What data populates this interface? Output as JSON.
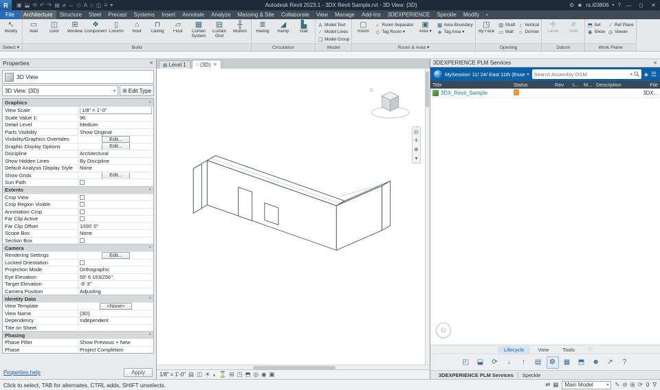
{
  "colors": {
    "titlebar": "#1f2a37",
    "tabrow": "#3e4a54",
    "file_blue": "#2a6bb5",
    "plm_blue": "#0d60a6",
    "selection_teal": "#1b7a8c",
    "status_orange": "#e89a3c"
  },
  "title_bar": {
    "app_title": "Autodesk Revit 2023.1 - 3DX Revit Sample.rvt - 3D View: {3D}",
    "logo_letter": "R",
    "qat_icons": [
      {
        "name": "open-file-icon",
        "glyph": "▣"
      },
      {
        "name": "save-icon",
        "glyph": "⬓"
      },
      {
        "name": "sync-icon",
        "glyph": "⟲"
      },
      {
        "name": "undo-icon",
        "glyph": "↶"
      },
      {
        "name": "redo-icon",
        "glyph": "↷"
      },
      {
        "name": "print-icon",
        "glyph": "▤"
      },
      {
        "name": "measure-icon",
        "glyph": "⌀"
      },
      {
        "name": "aligned-dimension-icon",
        "glyph": "↔"
      },
      {
        "name": "tag-by-category-icon",
        "glyph": "◇"
      },
      {
        "name": "text-icon",
        "glyph": "A"
      },
      {
        "name": "default-3d-view-icon",
        "glyph": "⌂"
      },
      {
        "name": "section-icon",
        "glyph": "◫"
      },
      {
        "name": "thin-lines-icon",
        "glyph": "≡"
      },
      {
        "name": "customize-qat-icon",
        "glyph": "▾"
      }
    ],
    "right_icons": [
      {
        "name": "gear-icon",
        "glyph": "⚙"
      },
      {
        "name": "user-avatar-icon",
        "glyph": "☻"
      }
    ],
    "user_name": "rs.i03806",
    "user_menu_icon": "▾",
    "help_icon": "?",
    "window": {
      "minimize_icon": "—",
      "restore_icon": "◻",
      "close_icon": "✕"
    }
  },
  "ribbon": {
    "file_label": "File",
    "tabs": [
      "Architecture",
      "Structure",
      "Steel",
      "Precast",
      "Systems",
      "Insert",
      "Annotate",
      "Analyze",
      "Massing & Site",
      "Collaborate",
      "View",
      "Manage",
      "Add-Ins",
      "3DEXPERIENCE",
      "Speckle",
      "Modify"
    ],
    "active_tab": "Architecture",
    "tab_overflow_icon": "▾",
    "panels": [
      {
        "label": "Select ▾",
        "items": [
          {
            "kind": "big",
            "label": "Modify",
            "icon": "↖"
          }
        ]
      },
      {
        "label": "Build",
        "items": [
          {
            "kind": "big",
            "label": "Wall",
            "icon": "▭"
          },
          {
            "kind": "big",
            "label": "Door",
            "icon": "◫"
          },
          {
            "kind": "big",
            "label": "Window",
            "icon": "⊞"
          },
          {
            "kind": "big",
            "label": "Component",
            "icon": "❖"
          },
          {
            "kind": "big",
            "label": "Column",
            "icon": "▯"
          },
          {
            "kind": "big",
            "label": "Roof",
            "icon": "⌂"
          },
          {
            "kind": "big",
            "label": "Ceiling",
            "icon": "⊓"
          },
          {
            "kind": "big",
            "label": "Floor",
            "icon": "▱"
          },
          {
            "kind": "big",
            "label": "Curtain System",
            "icon": "▦"
          },
          {
            "kind": "big",
            "label": "Curtain Grid",
            "icon": "▤"
          },
          {
            "kind": "big",
            "label": "Mullion",
            "icon": "╫"
          }
        ]
      },
      {
        "label": "Circulation",
        "items": [
          {
            "kind": "big",
            "label": "Railing",
            "icon": "≣"
          },
          {
            "kind": "big",
            "label": "Ramp",
            "icon": "◢"
          },
          {
            "kind": "big",
            "label": "Stair",
            "icon": "▙"
          }
        ]
      },
      {
        "label": "Model",
        "items": [
          {
            "kind": "stack",
            "items": [
              {
                "label": "Model Text",
                "icon": "A"
              },
              {
                "label": "Model Lines",
                "icon": "∕"
              },
              {
                "label": "Model Group",
                "icon": "❏"
              }
            ]
          }
        ]
      },
      {
        "label": "Room & Area ▾",
        "items": [
          {
            "kind": "big",
            "label": "Room",
            "icon": "▢"
          },
          {
            "kind": "stack",
            "items": [
              {
                "label": "Room Separator",
                "icon": "⌐"
              },
              {
                "label": "Tag Room ▾",
                "icon": "◇"
              }
            ]
          },
          {
            "kind": "big",
            "label": "Area ▾",
            "icon": "▣"
          },
          {
            "kind": "stack",
            "items": [
              {
                "label": "Area Boundary",
                "icon": "▩"
              },
              {
                "label": "Tag Area ▾",
                "icon": "◈"
              }
            ]
          }
        ]
      },
      {
        "label": "Opening",
        "items": [
          {
            "kind": "big",
            "label": "By Face",
            "icon": "◳"
          },
          {
            "kind": "stack",
            "items": [
              {
                "label": "Shaft",
                "icon": "▥"
              },
              {
                "label": "Wall",
                "icon": "▭"
              }
            ]
          },
          {
            "kind": "stack",
            "items": [
              {
                "label": "Vertical",
                "icon": "↕"
              },
              {
                "label": "Dormer",
                "icon": "⌂"
              }
            ]
          }
        ]
      },
      {
        "label": "Datum",
        "disabled": true,
        "items": [
          {
            "kind": "big",
            "label": "Level",
            "icon": "✛"
          },
          {
            "kind": "big",
            "label": "Grid",
            "icon": "#"
          }
        ]
      },
      {
        "label": "Work Plane",
        "items": [
          {
            "kind": "stack",
            "items": [
              {
                "label": "Set",
                "icon": "⬒"
              },
              {
                "label": "Show",
                "icon": "◉"
              }
            ]
          },
          {
            "kind": "stack",
            "items": [
              {
                "label": "Ref Plane",
                "icon": "∕"
              },
              {
                "label": "Viewer",
                "icon": "◎"
              }
            ]
          }
        ]
      }
    ]
  },
  "properties": {
    "title": "Properties",
    "close_icon": "✕",
    "type_name": "3D View",
    "instance_label": "3D View: {3D}",
    "dropdown_icon": "▾",
    "edit_type_icon": "▦",
    "edit_type_label": "Edit Type",
    "groups": [
      {
        "name": "Graphics",
        "rows": [
          {
            "label": "View Scale",
            "value": "1/8\" = 1'-0\"",
            "type": "select"
          },
          {
            "label": "Scale Value    1:",
            "value": "96",
            "type": "text"
          },
          {
            "label": "Detail Level",
            "value": "Medium",
            "type": "text"
          },
          {
            "label": "Parts Visibility",
            "value": "Show Original",
            "type": "text"
          },
          {
            "label": "Visibility/Graphics Overrides",
            "value": "Edit...",
            "type": "button"
          },
          {
            "label": "Graphic Display Options",
            "value": "Edit...",
            "type": "button"
          },
          {
            "label": "Discipline",
            "value": "Architectural",
            "type": "text"
          },
          {
            "label": "Show Hidden Lines",
            "value": "By Discipline",
            "type": "text"
          },
          {
            "label": "Default Analysis Display Style",
            "value": "None",
            "type": "text"
          },
          {
            "label": "Show Grids",
            "value": "Edit...",
            "type": "button"
          },
          {
            "label": "Sun Path",
            "value": "",
            "type": "checkbox"
          }
        ]
      },
      {
        "name": "Extents",
        "rows": [
          {
            "label": "Crop View",
            "value": "",
            "type": "checkbox"
          },
          {
            "label": "Crop Region Visible",
            "value": "",
            "type": "checkbox"
          },
          {
            "label": "Annotation Crop",
            "value": "",
            "type": "checkbox"
          },
          {
            "label": "Far Clip Active",
            "value": "",
            "type": "checkbox"
          },
          {
            "label": "Far Clip Offset",
            "value": "1000' 0\"",
            "type": "text"
          },
          {
            "label": "Scope Box",
            "value": "None",
            "type": "text"
          },
          {
            "label": "Section Box",
            "value": "",
            "type": "checkbox"
          }
        ]
      },
      {
        "name": "Camera",
        "rows": [
          {
            "label": "Rendering Settings",
            "value": "Edit...",
            "type": "button"
          },
          {
            "label": "Locked Orientation",
            "value": "",
            "type": "checkbox"
          },
          {
            "label": "Projection Mode",
            "value": "Orthographic",
            "type": "text"
          },
          {
            "label": "Eye Elevation",
            "value": "50' 6 153/256\"",
            "type": "text"
          },
          {
            "label": "Target Elevation",
            "value": "-9' 3\"",
            "type": "text"
          },
          {
            "label": "Camera Position",
            "value": "Adjusting",
            "type": "text"
          }
        ]
      },
      {
        "name": "Identity Data",
        "rows": [
          {
            "label": "View Template",
            "value": "<None>",
            "type": "button"
          },
          {
            "label": "View Name",
            "value": "{3D}",
            "type": "text"
          },
          {
            "label": "Dependency",
            "value": "Independent",
            "type": "text"
          },
          {
            "label": "Title on Sheet",
            "value": "",
            "type": "text"
          }
        ]
      },
      {
        "name": "Phasing",
        "rows": [
          {
            "label": "Phase Filter",
            "value": "Show Previous + New",
            "type": "text"
          },
          {
            "label": "Phase",
            "value": "Project Completion",
            "type": "text"
          }
        ]
      }
    ],
    "help_link": "Properties help",
    "apply_label": "Apply"
  },
  "view_tabs": {
    "tabs": [
      {
        "label": "Level 1",
        "icon": "▦"
      },
      {
        "label": "(3D)",
        "icon": "⌂"
      }
    ],
    "active": "(3D)",
    "close_icon": "✕"
  },
  "viewport": {
    "viewcube_home_icon": "⌂",
    "navbar_icons": [
      {
        "name": "navigation-wheel-icon",
        "glyph": "◎"
      },
      {
        "name": "pan-icon",
        "glyph": "✛"
      },
      {
        "name": "zoom-icon",
        "glyph": "⊕"
      },
      {
        "name": "navbar-more-icon",
        "glyph": "▾"
      }
    ]
  },
  "view_controls": {
    "scale": "1/8\" = 1'-0\"",
    "icons": [
      {
        "name": "detail-level-icon",
        "glyph": "▤"
      },
      {
        "name": "visual-style-icon",
        "glyph": "◫"
      },
      {
        "name": "sun-path-icon",
        "glyph": "☀"
      },
      {
        "name": "shadows-icon",
        "glyph": "◐"
      },
      {
        "name": "render-icon",
        "glyph": "⌛"
      },
      {
        "name": "crop-view-icon",
        "glyph": "⊞"
      },
      {
        "name": "show-crop-region-icon",
        "glyph": "◳"
      },
      {
        "name": "lock-view-icon",
        "glyph": "⬒"
      },
      {
        "name": "hide-isolate-icon",
        "glyph": "◎"
      },
      {
        "name": "reveal-hidden-icon",
        "glyph": "◉"
      },
      {
        "name": "view-properties-icon",
        "glyph": "▣"
      }
    ]
  },
  "status_bar": {
    "hint": "Click to select, TAB for alternates, CTRL adds, SHIFT unselects.",
    "pre_icons": [
      {
        "name": "worksets-icon",
        "glyph": "⇄"
      },
      {
        "name": "design-options-icon",
        "glyph": "▦"
      }
    ],
    "main_model_label": "Main Model",
    "dropdown_icon": "▾",
    "post_icons": [
      {
        "name": "editable-only-icon",
        "glyph": "✎"
      },
      {
        "name": "exclude-options-icon",
        "glyph": "⊘"
      },
      {
        "name": "press-drag-icon",
        "glyph": "⊞"
      },
      {
        "name": "background-processes-icon",
        "glyph": "⟳"
      }
    ],
    "filter_count": "0",
    "filter_icon": "∇"
  },
  "plm_panel": {
    "title": "3DEXPERIENCE PLM Services",
    "close_icon": "✕",
    "session_user": "MySession",
    "session_context": "11/ 24/ East 11th (Esse",
    "session_arrow": "▾",
    "search_placeholder": "Search Assembly OSM",
    "search_arrow": "▾",
    "tag_icon": "◈",
    "menu_icon": "☰",
    "table": {
      "columns": [
        "Title",
        "Status",
        "Rev",
        "I...",
        "M...",
        "Description",
        "File"
      ],
      "rows": [
        {
          "title": "3DX_Revit_Sample",
          "file": "3DX..."
        }
      ]
    },
    "tabs": [
      "Lifecycle",
      "View",
      "Tools"
    ],
    "active_tab": "Lifecycle",
    "favorite_icon": "♡",
    "toolbar_icons": [
      {
        "name": "open-in-session-icon",
        "glyph": "◰"
      },
      {
        "name": "save-to-3dx-icon",
        "glyph": "⬓"
      },
      {
        "name": "refresh-icon",
        "glyph": "⟳"
      },
      {
        "name": "import-icon",
        "glyph": "↓"
      },
      {
        "name": "export-icon",
        "glyph": "↑"
      },
      {
        "name": "properties-icon",
        "glyph": "▤"
      },
      {
        "name": "settings-gear-icon",
        "glyph": "⚙",
        "active": true
      },
      {
        "name": "table-view-icon",
        "glyph": "▦"
      },
      {
        "name": "lock-icon",
        "glyph": "⬒"
      },
      {
        "name": "collaborate-icon",
        "glyph": "☻"
      },
      {
        "name": "share-icon",
        "glyph": "↗"
      },
      {
        "name": "help-icon",
        "glyph": "?"
      }
    ],
    "assistant_icon": "☺",
    "footer_tabs": [
      "3DEXPERIENCE PLM Services",
      "Speckle"
    ],
    "footer_active": "3DEXPERIENCE PLM Services"
  }
}
